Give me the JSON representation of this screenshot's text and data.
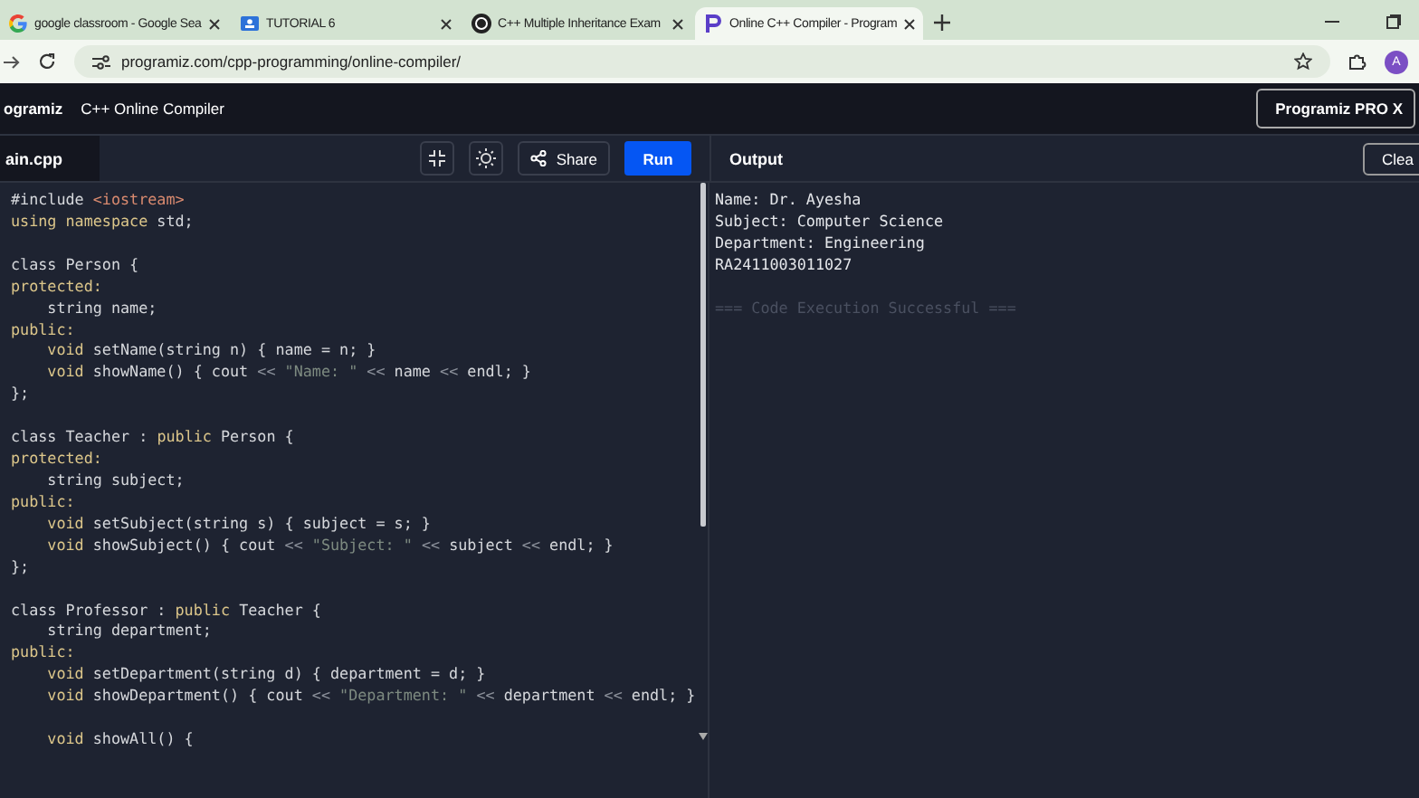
{
  "browser_tabs": [
    {
      "title": "google classroom - Google Sea",
      "selected": false
    },
    {
      "title": "TUTORIAL 6",
      "selected": false
    },
    {
      "title": "C++ Multiple Inheritance Exam",
      "selected": false
    },
    {
      "title": "Online C++ Compiler - Program",
      "selected": true
    }
  ],
  "address_bar": {
    "url": "programiz.com/cpp-programming/online-compiler/",
    "avatar": "A"
  },
  "header": {
    "logo": "ogramiz",
    "title": "C++ Online Compiler",
    "pro_button": "Programiz PRO X"
  },
  "toolbar": {
    "file_tab": "ain.cpp",
    "share": "Share",
    "run": "Run",
    "output_title": "Output",
    "clear": "Clea"
  },
  "code_lines": [
    [
      {
        "text": "#include ",
        "kind": "plain"
      },
      {
        "text": "<iostream>",
        "kind": "inc"
      }
    ],
    [
      {
        "text": "using namespace",
        "kind": "kw"
      },
      {
        "text": " std;",
        "kind": "plain"
      }
    ],
    [
      {
        "kind": "blank"
      }
    ],
    [
      {
        "text": "class Person {",
        "kind": "plain"
      }
    ],
    [
      {
        "text": "protected:",
        "kind": "kw"
      }
    ],
    [
      {
        "text": "    string name;",
        "kind": "plain"
      }
    ],
    [
      {
        "text": "public:",
        "kind": "kw"
      }
    ],
    [
      {
        "text": "    void",
        "kind": "kw"
      },
      {
        "text": " setName(string n) { name = n; }",
        "kind": "plain"
      }
    ],
    [
      {
        "text": "    void",
        "kind": "kw"
      },
      {
        "text": " showName() { cout ",
        "kind": "plain"
      },
      {
        "text": "<<",
        "kind": "op"
      },
      {
        "text": " \"Name: \" ",
        "kind": "str"
      },
      {
        "text": "<<",
        "kind": "op"
      },
      {
        "text": " name ",
        "kind": "plain"
      },
      {
        "text": "<<",
        "kind": "op"
      },
      {
        "text": " endl; }",
        "kind": "plain"
      }
    ],
    [
      {
        "text": "};",
        "kind": "plain"
      }
    ],
    [
      {
        "kind": "blank"
      }
    ],
    [
      {
        "text": "class Teacher : ",
        "kind": "plain"
      },
      {
        "text": "public",
        "kind": "kw"
      },
      {
        "text": " Person {",
        "kind": "plain"
      }
    ],
    [
      {
        "text": "protected:",
        "kind": "kw"
      }
    ],
    [
      {
        "text": "    string subject;",
        "kind": "plain"
      }
    ],
    [
      {
        "text": "public:",
        "kind": "kw"
      }
    ],
    [
      {
        "text": "    void",
        "kind": "kw"
      },
      {
        "text": " setSubject(string s) { subject = s; }",
        "kind": "plain"
      }
    ],
    [
      {
        "text": "    void",
        "kind": "kw"
      },
      {
        "text": " showSubject() { cout ",
        "kind": "plain"
      },
      {
        "text": "<<",
        "kind": "op"
      },
      {
        "text": " \"Subject: \" ",
        "kind": "str"
      },
      {
        "text": "<<",
        "kind": "op"
      },
      {
        "text": " subject ",
        "kind": "plain"
      },
      {
        "text": "<<",
        "kind": "op"
      },
      {
        "text": " endl; }",
        "kind": "plain"
      }
    ],
    [
      {
        "text": "};",
        "kind": "plain"
      }
    ],
    [
      {
        "kind": "blank"
      }
    ],
    [
      {
        "text": "class Professor : ",
        "kind": "plain"
      },
      {
        "text": "public",
        "kind": "kw"
      },
      {
        "text": " Teacher {",
        "kind": "plain"
      }
    ],
    [
      {
        "text": "    string department;",
        "kind": "plain"
      }
    ],
    [
      {
        "text": "public:",
        "kind": "kw"
      }
    ],
    [
      {
        "text": "    void",
        "kind": "kw"
      },
      {
        "text": " setDepartment(string d) { department = d; }",
        "kind": "plain"
      }
    ],
    [
      {
        "text": "    void",
        "kind": "kw"
      },
      {
        "text": " showDepartment() { cout ",
        "kind": "plain"
      },
      {
        "text": "<<",
        "kind": "op"
      },
      {
        "text": " \"Department: \" ",
        "kind": "str"
      },
      {
        "text": "<<",
        "kind": "op"
      },
      {
        "text": " department ",
        "kind": "plain"
      },
      {
        "text": "<<",
        "kind": "op"
      },
      {
        "text": " endl; }",
        "kind": "plain"
      }
    ],
    [
      {
        "kind": "blank"
      }
    ],
    [
      {
        "text": "    void",
        "kind": "kw"
      },
      {
        "text": " showAll() {",
        "kind": "plain"
      }
    ]
  ],
  "output_lines": [
    {
      "text": "Name: Dr. Ayesha",
      "kind": "out"
    },
    {
      "text": "Subject: Computer Science",
      "kind": "out"
    },
    {
      "text": "Department: Engineering",
      "kind": "out"
    },
    {
      "text": "RA2411003011027",
      "kind": "out"
    },
    {
      "kind": "blank"
    },
    {
      "text": "=== Code Execution Successful ===",
      "kind": "status"
    }
  ]
}
